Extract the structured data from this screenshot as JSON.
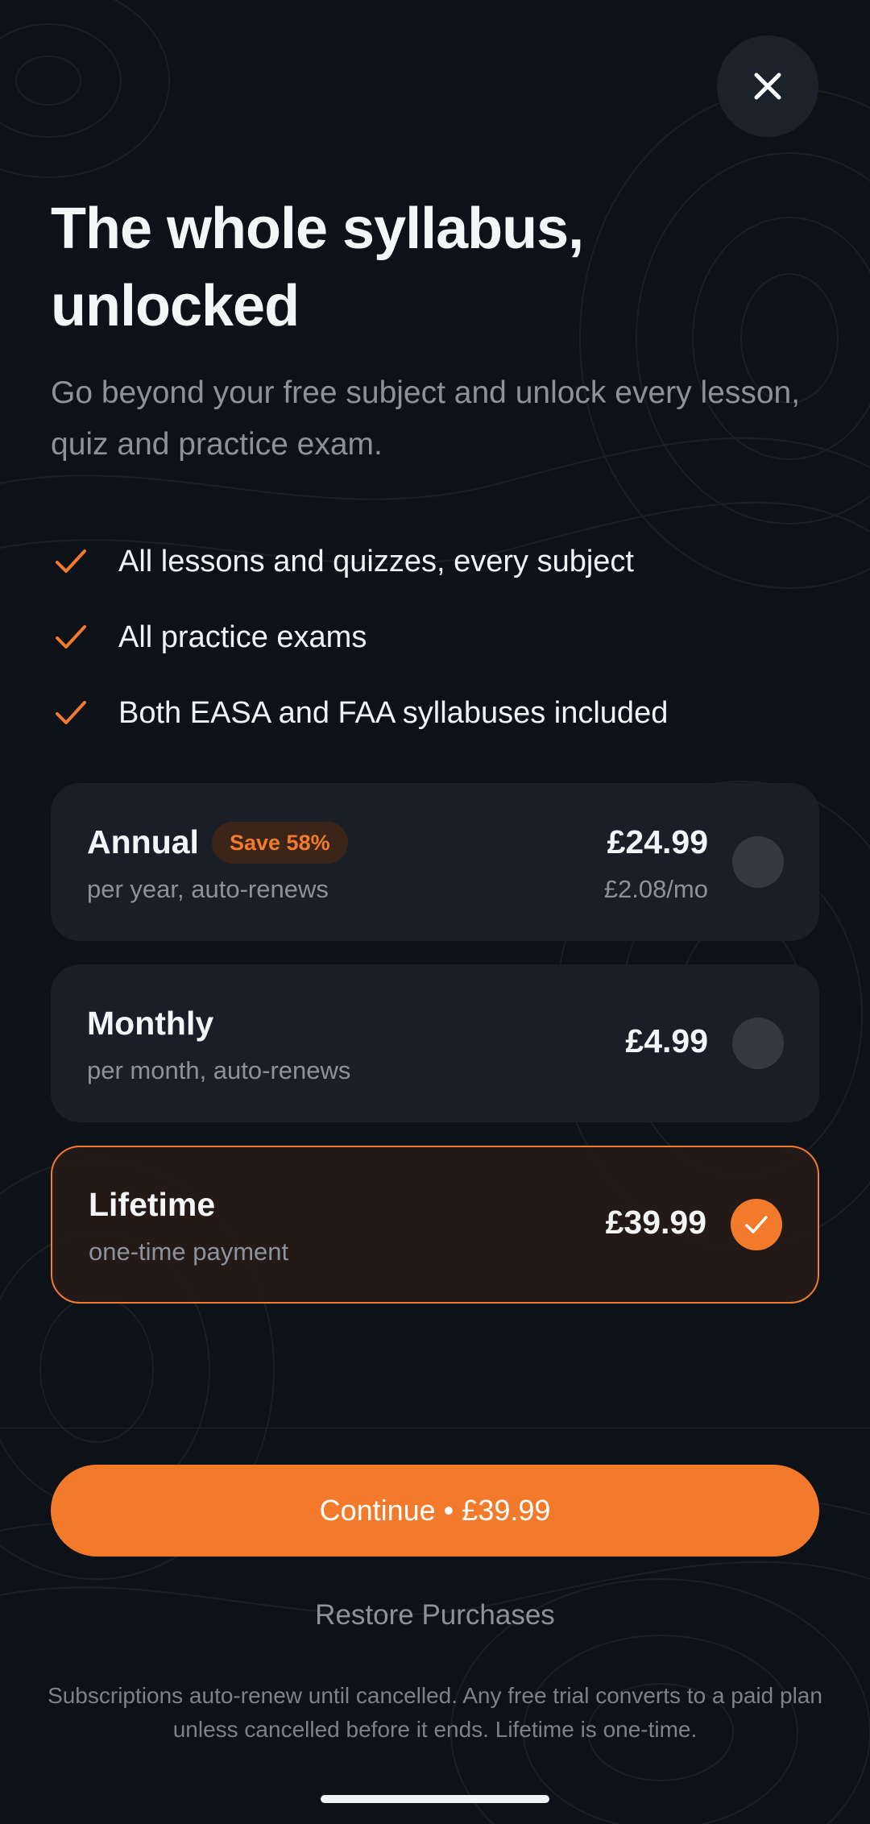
{
  "header": {
    "close_icon": "close-icon",
    "title": "The whole syllabus, unlocked",
    "subtitle": "Go beyond your free subject and unlock every lesson, quiz and practice exam."
  },
  "features": [
    {
      "icon": "checkmark-icon",
      "text": "All lessons and quizzes, every subject"
    },
    {
      "icon": "checkmark-icon",
      "text": "All practice exams"
    },
    {
      "icon": "checkmark-icon",
      "text": "Both EASA and FAA syllabuses included"
    }
  ],
  "plans": [
    {
      "name": "Annual",
      "badge": "Save 58%",
      "description": "per year, auto-renews",
      "price": "£24.99",
      "price_sub": "£2.08/mo",
      "selected": false
    },
    {
      "name": "Monthly",
      "description": "per month, auto-renews",
      "price": "£4.99",
      "selected": false
    },
    {
      "name": "Lifetime",
      "description": "one-time payment",
      "price": "£39.99",
      "selected": true
    }
  ],
  "cta": {
    "label": "Continue • £39.99"
  },
  "restore": {
    "label": "Restore Purchases"
  },
  "legal": {
    "text": "Subscriptions auto-renew until cancelled. Any free trial converts to a paid plan unless cancelled before it ends. Lifetime is one-time."
  },
  "colors": {
    "background": "#0d1118",
    "accent": "#f37a2b",
    "card": "#1b2029",
    "selected_card": "#251b18",
    "muted_text": "#8c929c"
  }
}
